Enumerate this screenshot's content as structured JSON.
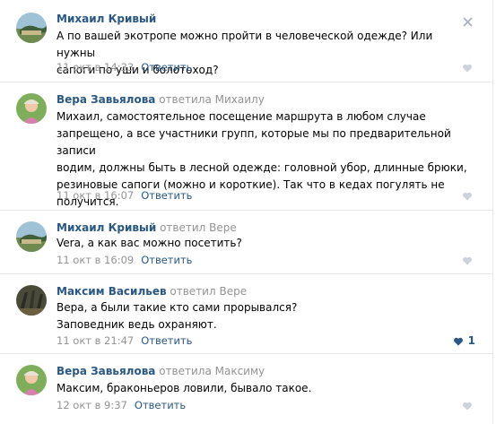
{
  "comments": [
    {
      "author": "Михаил Кривый",
      "reply_to": "",
      "text_lines": [
        "А по вашей экотропе можно пройти в человеческой одежде? Или нужны",
        "сапоги по уши и болотоход?"
      ],
      "date": "11 окт в 14:33",
      "reply_label": "Ответить",
      "likes": ""
    },
    {
      "author": "Вера Завьялова",
      "reply_to": "ответила Михаилу",
      "text_lines": [
        "Михаил, самостоятельное посещение маршрута в любом случае",
        "запрещено, а все участники групп, которые мы по предварительной записи",
        "водим, должны быть в лесной одежде: головной убор, длинные брюки,",
        "резиновые сапоги (можно и короткие). Так что в кедах погулять не",
        "получится."
      ],
      "date": "11 окт в 16:07",
      "reply_label": "Ответить",
      "likes": ""
    },
    {
      "author": "Михаил Кривый",
      "reply_to": "ответил Вере",
      "text_lines": [
        "Vera, а как вас можно посетить?"
      ],
      "date": "11 окт в 16:09",
      "reply_label": "Ответить",
      "likes": ""
    },
    {
      "author": "Максим Васильев",
      "reply_to": "ответил Вере",
      "text_lines": [
        "Вера, а были такие кто сами прорывался?",
        "Заповедник ведь охраняют."
      ],
      "date": "11 окт в 21:47",
      "reply_label": "Ответить",
      "likes": "1"
    },
    {
      "author": "Вера Завьялова",
      "reply_to": "ответила Максиму",
      "text_lines": [
        "Максим, браконьеров ловили, бывало такое."
      ],
      "date": "12 окт в 9:37",
      "reply_label": "Ответить",
      "likes": ""
    }
  ],
  "colors": {
    "author": "#2a5885",
    "muted": "#939393",
    "like_icon": "#cdd3dc",
    "like_active": "#2a5885",
    "divider": "#e7e8ec"
  },
  "icons": {
    "close": "close-icon",
    "like": "heart-icon"
  }
}
